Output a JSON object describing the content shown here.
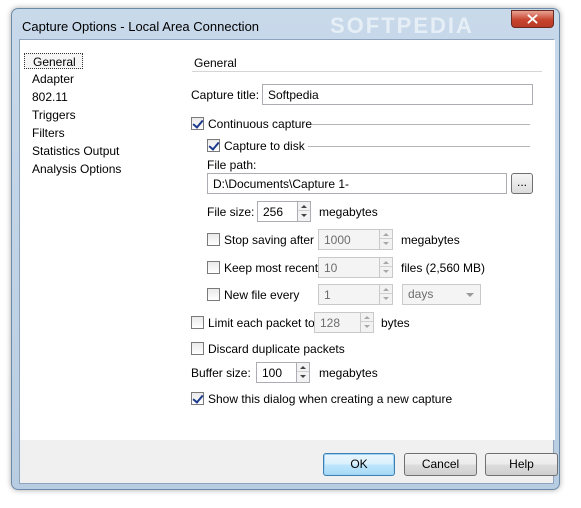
{
  "window": {
    "title": "Capture Options - Local Area Connection",
    "watermark": "SOFTPEDIA"
  },
  "nav": {
    "items": [
      {
        "label": "General",
        "selected": true
      },
      {
        "label": "Adapter"
      },
      {
        "label": "802.11"
      },
      {
        "label": "Triggers"
      },
      {
        "label": "Filters"
      },
      {
        "label": "Statistics Output"
      },
      {
        "label": "Analysis Options"
      }
    ]
  },
  "general": {
    "section_title": "General",
    "capture_title": {
      "label": "Capture title:",
      "value": "Softpedia"
    },
    "continuous_capture": {
      "label": "Continuous capture",
      "checked": true
    },
    "capture_to_disk": {
      "label": "Capture to disk",
      "checked": true
    },
    "file_path": {
      "label": "File path:",
      "value": "D:\\Documents\\Capture 1-",
      "browse_label": "..."
    },
    "file_size": {
      "label": "File size:",
      "value": "256",
      "unit": "megabytes"
    },
    "stop_saving": {
      "label": "Stop saving after",
      "value": "1000",
      "unit": "megabytes",
      "checked": false
    },
    "keep_most_recent": {
      "label": "Keep most recent",
      "value": "10",
      "unit": "files (2,560 MB)",
      "checked": false
    },
    "new_file_every": {
      "label": "New file every",
      "value": "1",
      "interval": "days",
      "checked": false
    },
    "limit_packet": {
      "label": "Limit each packet to",
      "value": "128",
      "unit": "bytes",
      "checked": false
    },
    "discard_duplicates": {
      "label": "Discard duplicate packets",
      "checked": false
    },
    "buffer_size": {
      "label": "Buffer size:",
      "value": "100",
      "unit": "megabytes"
    },
    "show_dialog": {
      "label": "Show this dialog when creating a new capture",
      "checked": true
    }
  },
  "buttons": {
    "ok": "OK",
    "cancel": "Cancel",
    "help": "Help"
  }
}
